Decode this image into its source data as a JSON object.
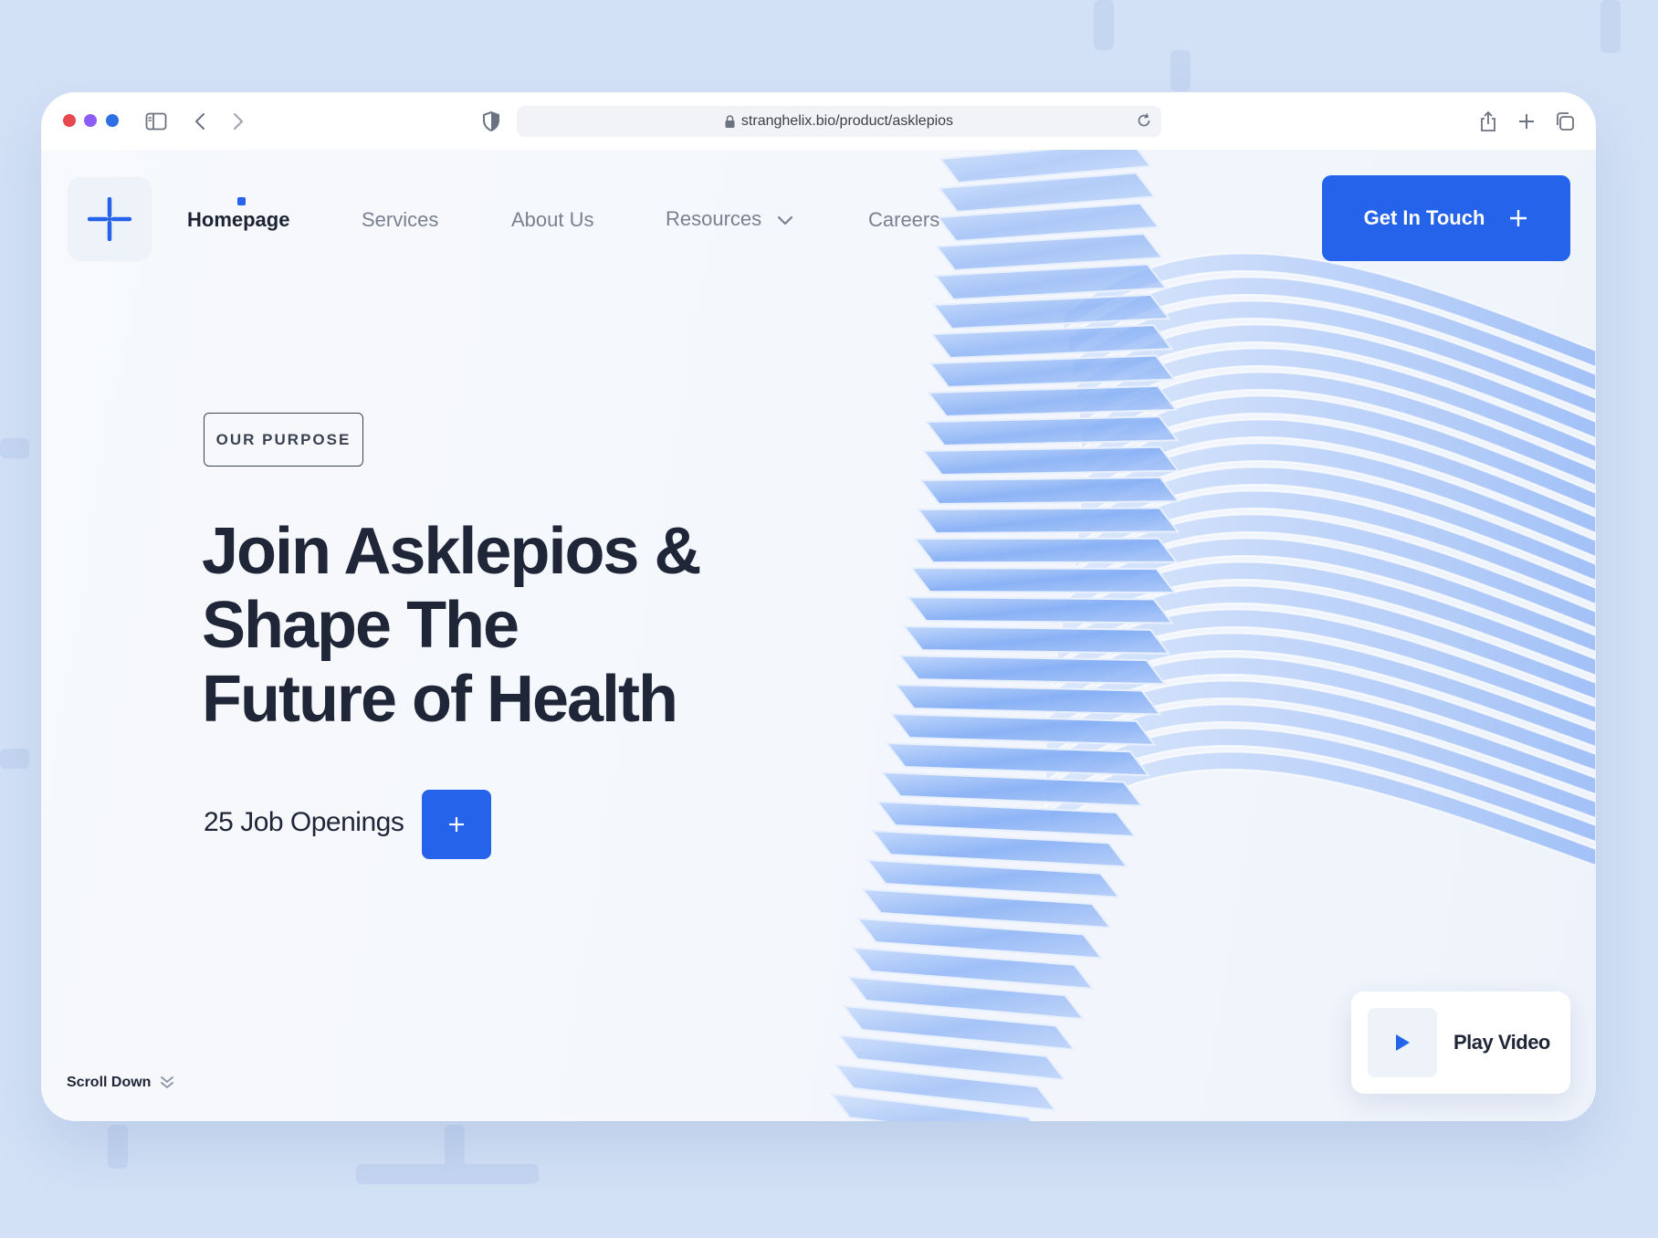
{
  "browser": {
    "url": "stranghelix.bio/product/asklepios",
    "traffic_lights": [
      "#e5484d",
      "#8b5cf6",
      "#2f6fe4"
    ]
  },
  "nav": {
    "items": [
      {
        "label": "Homepage",
        "active": true
      },
      {
        "label": "Services"
      },
      {
        "label": "About Us"
      },
      {
        "label": "Resources",
        "has_dropdown": true
      },
      {
        "label": "Careers"
      }
    ],
    "cta_label": "Get In Touch"
  },
  "hero": {
    "badge": "OUR PURPOSE",
    "headline": [
      "Join Asklepios &",
      "Shape The",
      "Future of Health"
    ],
    "openings": "25 Job Openings"
  },
  "scroll_label": "Scroll Down",
  "video_label": "Play Video",
  "colors": {
    "accent": "#2563eb",
    "heading": "#1f2637",
    "nav_inactive": "#7a8090"
  }
}
